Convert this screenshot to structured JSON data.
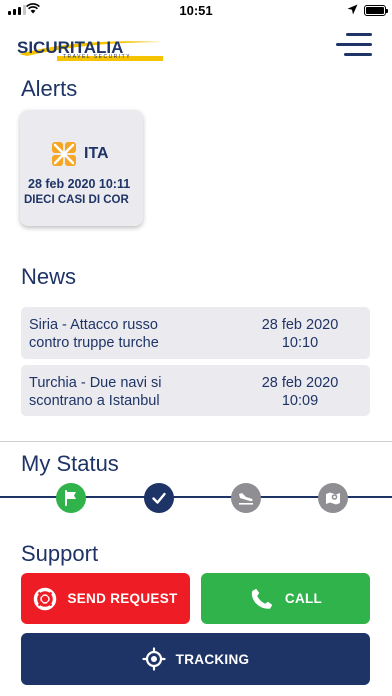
{
  "status_bar": {
    "time": "10:51",
    "signal_bars_filled": 3,
    "signal_bars_total": 4,
    "battery_level_pct": 100
  },
  "header": {
    "logo_text": "SICURITALIA",
    "logo_subtext": "TRAVEL SECURITY",
    "menu_icon": "hamburger-menu-icon"
  },
  "alerts": {
    "title": "Alerts",
    "items": [
      {
        "country_code": "ITA",
        "date": "28 feb 2020 10:11",
        "headline": "DIECI CASI DI COR",
        "icon": "virus-alert-icon",
        "icon_color": "#f6a623"
      }
    ]
  },
  "news": {
    "title": "News",
    "items": [
      {
        "title_line1": "Siria - Attacco russo",
        "title_line2": "contro truppe turche",
        "date": "28 feb 2020",
        "time": "10:10"
      },
      {
        "title_line1": "Turchia - Due navi si",
        "title_line2": "scontrano a Istanbul",
        "date": "28 feb 2020",
        "time": "10:09"
      }
    ]
  },
  "my_status": {
    "title": "My Status",
    "steps": [
      {
        "icon": "flag-icon",
        "color": "#2fb34a",
        "state": "active"
      },
      {
        "icon": "checkmark-icon",
        "color": "#1f3466",
        "state": "done"
      },
      {
        "icon": "plane-landing-icon",
        "color": "#8e8e93",
        "state": "inactive"
      },
      {
        "icon": "map-pin-icon",
        "color": "#8e8e93",
        "state": "inactive"
      }
    ]
  },
  "support": {
    "title": "Support",
    "send_request_label": "SEND REQUEST",
    "call_label": "CALL",
    "tracking_label": "TRACKING",
    "colors": {
      "send_request": "#ee1c25",
      "call": "#2fb34a",
      "tracking": "#1f3466"
    }
  },
  "colors": {
    "primary": "#1f3466",
    "card_bg": "#ebebef",
    "logo_accent": "#f6c300"
  }
}
